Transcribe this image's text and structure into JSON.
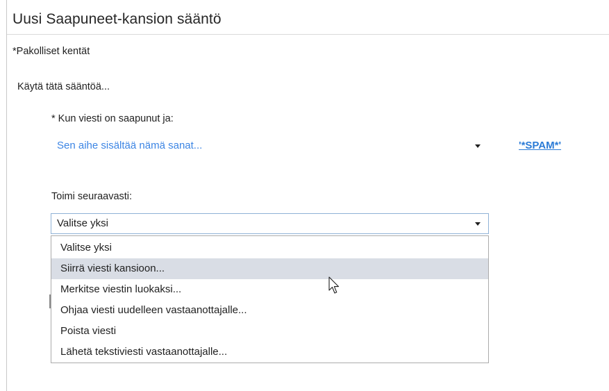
{
  "dialog": {
    "title": "Uusi Saapuneet-kansion sääntö",
    "required_note": "*Pakolliset kentät",
    "apply_label": "Käytä tätä sääntöä..."
  },
  "condition": {
    "label": "* Kun viesti on saapunut ja:",
    "selected": "Sen aihe sisältää nämä sanat...",
    "value_link": "'*SPAM*'"
  },
  "action": {
    "label": "Toimi seuraavasti:",
    "selected": "Valitse yksi",
    "options": [
      "Valitse yksi",
      "Siirrä viesti kansioon...",
      "Merkitse viestin luokaksi...",
      "Ohjaa viesti uudelleen vastaanottajalle...",
      "Poista viesti",
      "Lähetä tekstiviesti vastaanottajalle..."
    ],
    "hovered_index": 1
  },
  "icons": {
    "caret": "chevron-down-icon",
    "pointer": "mouse-pointer-icon"
  },
  "colors": {
    "link": "#2b7bd6",
    "condition_text": "#3c85e4",
    "hover_bg": "#d9dde5",
    "focus_border": "#8fb2d6"
  }
}
